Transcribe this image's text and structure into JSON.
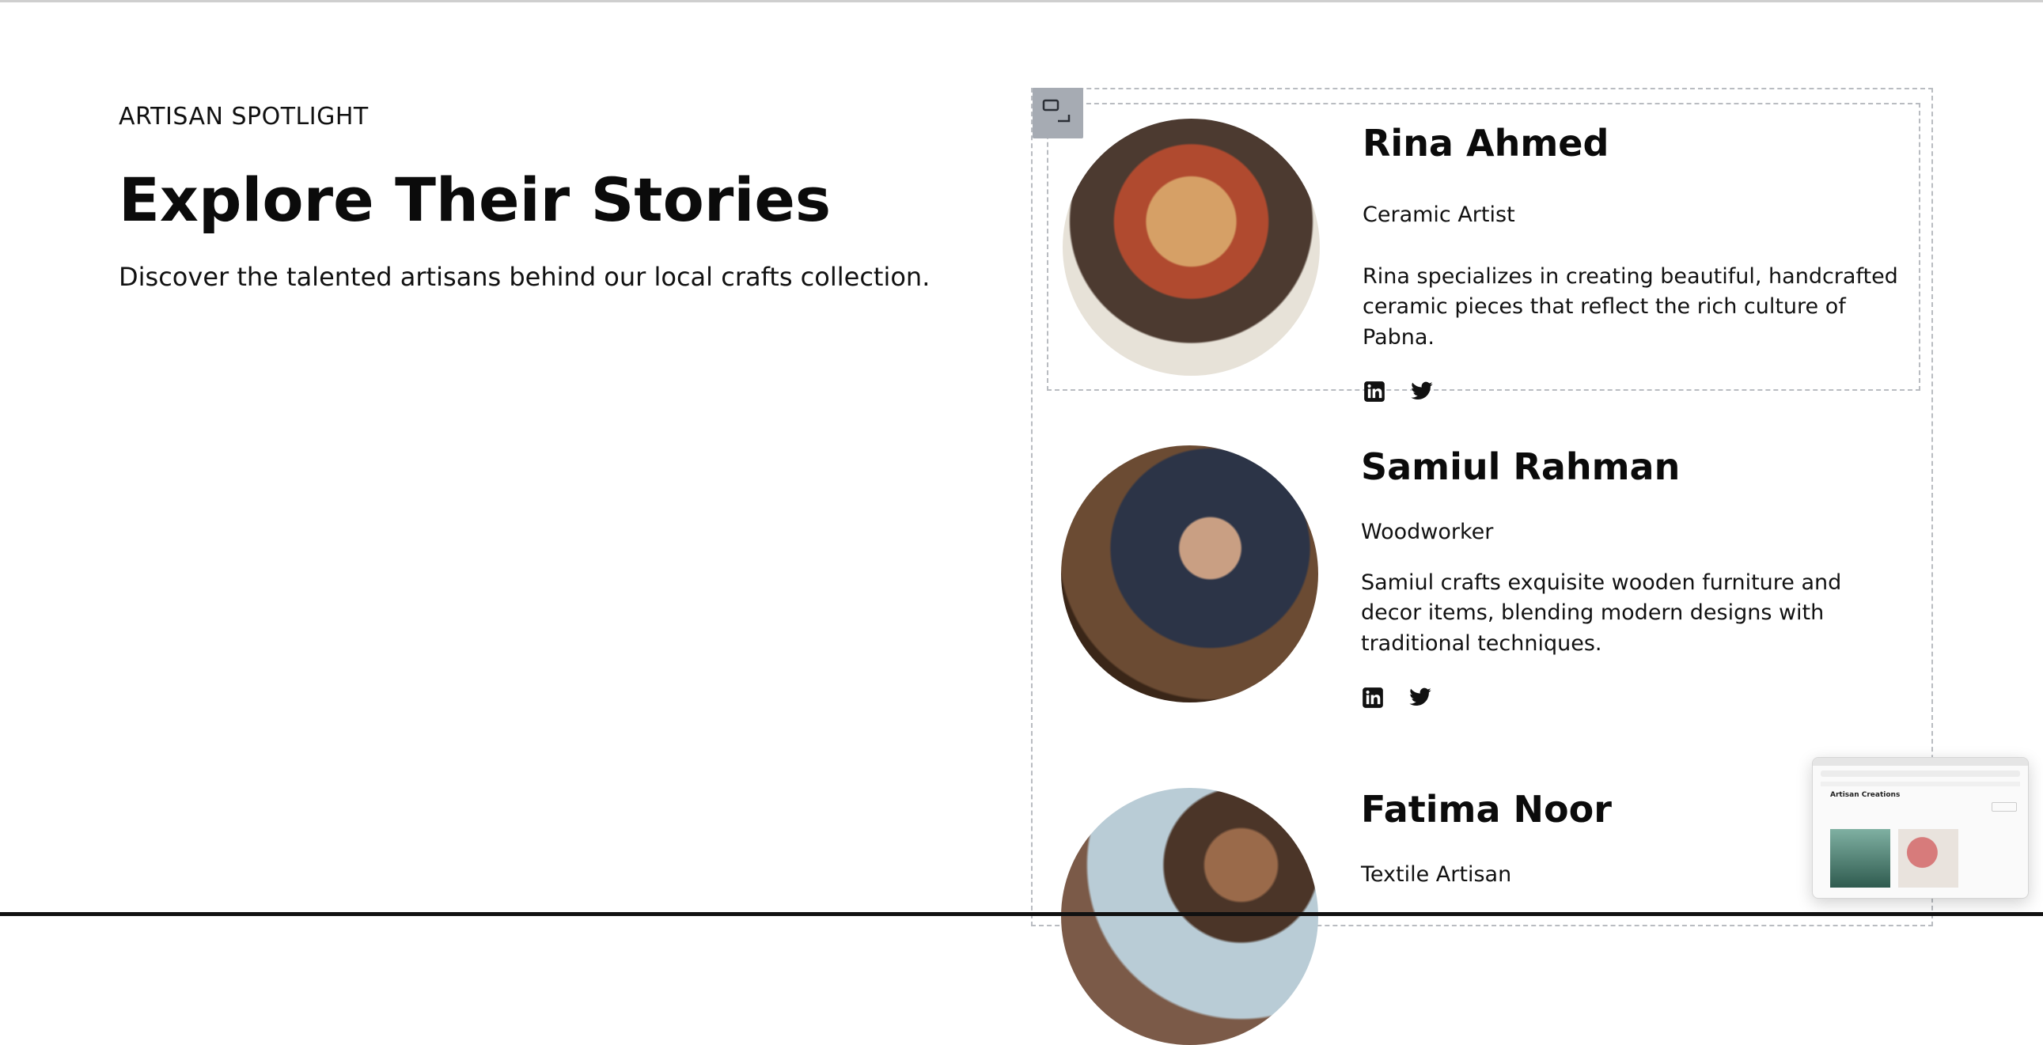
{
  "intro": {
    "eyebrow": "ARTISAN SPOTLIGHT",
    "title": "Explore Their Stories",
    "subtitle": "Discover the talented artisans behind our local crafts collection."
  },
  "artisans": [
    {
      "name": "Rina Ahmed",
      "role": "Ceramic Artist",
      "bio": "Rina specializes in creating beautiful, handcrafted ceramic pieces that reflect the rich culture of Pabna.",
      "socials": [
        "linkedin-icon",
        "twitter-icon"
      ]
    },
    {
      "name": "Samiul Rahman",
      "role": "Woodworker",
      "bio": "Samiul crafts exquisite wooden furniture and decor items, blending modern designs with traditional techniques.",
      "socials": [
        "linkedin-icon",
        "twitter-icon"
      ]
    },
    {
      "name": "Fatima Noor",
      "role": "Textile Artisan",
      "bio": "",
      "socials": []
    }
  ],
  "preview": {
    "title": "Artisan Creations"
  },
  "colors": {
    "text": "#111111",
    "dashed_border": "#b9bcc1",
    "handle": "#a6abb3"
  }
}
